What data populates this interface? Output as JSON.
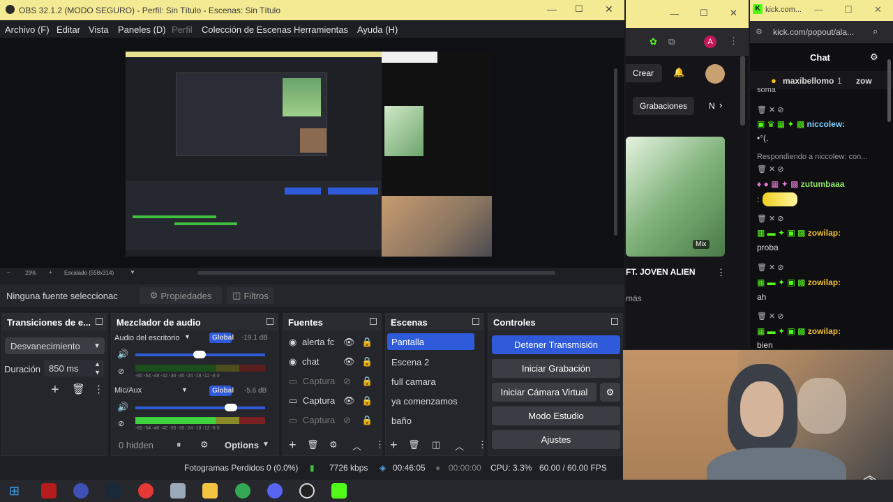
{
  "obs": {
    "title": "OBS 32.1.2 (MODO SEGURO) - Perfil: Sin Título - Escenas: Sin Título",
    "menu": [
      "Archivo (F)",
      "Editar",
      "Vista",
      "Paneles (D)",
      "Perfil",
      "Colección de Escenas",
      "Herramientas",
      "Ayuda (H)"
    ],
    "zoom": "29%",
    "scaled": "Escalado (558x314)",
    "no_source": "Ninguna fuente seleccionac",
    "properties": "Propiedades",
    "filters": "Filtros",
    "transitions": {
      "title": "Transiciones de e...",
      "selected": "Desvanecimiento",
      "duration_label": "Duración",
      "duration_value": "850 ms"
    },
    "mixer": {
      "title": "Mezclador de audio",
      "tracks": [
        {
          "name": "Audio del escritorio",
          "scope": "Global",
          "db": "-19.1 dB"
        },
        {
          "name": "Mic/Aux",
          "scope": "Global",
          "db": "-5.6 dB"
        }
      ],
      "scale": "-60 -54 -48 -42 -36 -30 -24 -18 -12 -6 0",
      "hidden": "0 hidden",
      "options": "Options"
    },
    "sources": {
      "title": "Fuentes",
      "items": [
        "alerta fc",
        "chat",
        "Captura",
        "Captura",
        "Captura"
      ]
    },
    "scenes": {
      "title": "Escenas",
      "items": [
        "Pantalla",
        "Escena 2",
        "full camara",
        "ya comenzamos",
        "baño"
      ],
      "selected": 0
    },
    "controls": {
      "title": "Controles",
      "stop_stream": "Detener Transmisión",
      "start_rec": "Iniciar Grabación",
      "virtual_cam": "Iniciar Cámara Virtual",
      "studio": "Modo Estudio",
      "settings": "Ajustes"
    },
    "status": {
      "dropped": "Fotogramas Perdidos 0 (0.0%)",
      "kbps": "7726 kbps",
      "stream_time": "00:46:05",
      "rec_time": "00:00:00",
      "cpu": "CPU: 3.3%",
      "fps": "60.00 / 60.00 FPS"
    }
  },
  "browser1": {
    "create": "Crear",
    "recordings": "Grabaciones",
    "video_title": "FT. JOVEN ALIEN",
    "more": "más",
    "mix": "Mix",
    "nav_fragment": "N"
  },
  "browser2": {
    "tab": "kick.com...",
    "url": "kick.com/popout/ala...",
    "chat_title": "Chat",
    "top": [
      "maxibellomo",
      "1",
      "zow"
    ],
    "messages": [
      {
        "fragment": "soma"
      },
      {
        "user": "niccolew:",
        "text": "•°(."
      },
      {
        "reply": "Respondiendo a niccolew: con..."
      },
      {
        "user": "zutumbaaa",
        "text": ":"
      },
      {
        "user": "zowilap:",
        "text": "proba"
      },
      {
        "user": "zowilap:",
        "text": "ah"
      },
      {
        "user": "zowilap:",
        "text": "bien"
      }
    ]
  },
  "colors": {
    "title_bar": "#f4ea93",
    "accent": "#2f5bdb",
    "kick_green": "#53fc18",
    "user_green": "#8fe36a"
  }
}
